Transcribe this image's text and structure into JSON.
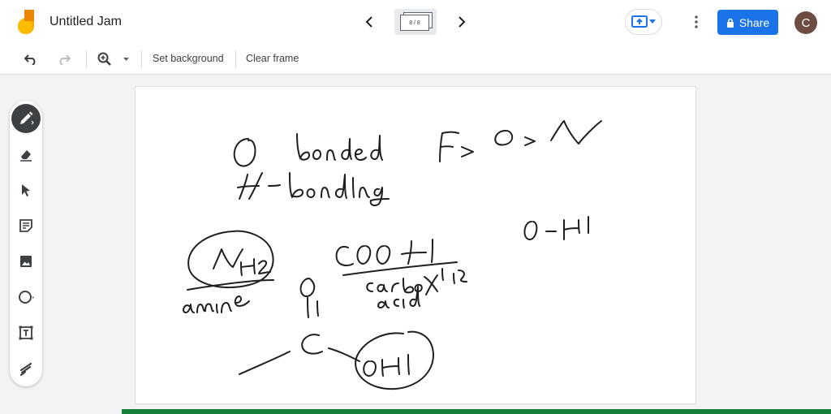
{
  "app": {
    "title": "Untitled Jam",
    "frame_indicator": "8 / 8",
    "share_label": "Share",
    "avatar_initial": "C"
  },
  "toolbar": {
    "set_background": "Set background",
    "clear_frame": "Clear frame"
  },
  "tools": [
    "pen-icon",
    "eraser-icon",
    "select-icon",
    "sticky-note-icon",
    "image-icon",
    "circle-icon",
    "text-box-icon",
    "laser-icon"
  ],
  "colors": {
    "accent": "#1a73e8",
    "progress": "#188038",
    "ink": "#1f1f1f"
  }
}
